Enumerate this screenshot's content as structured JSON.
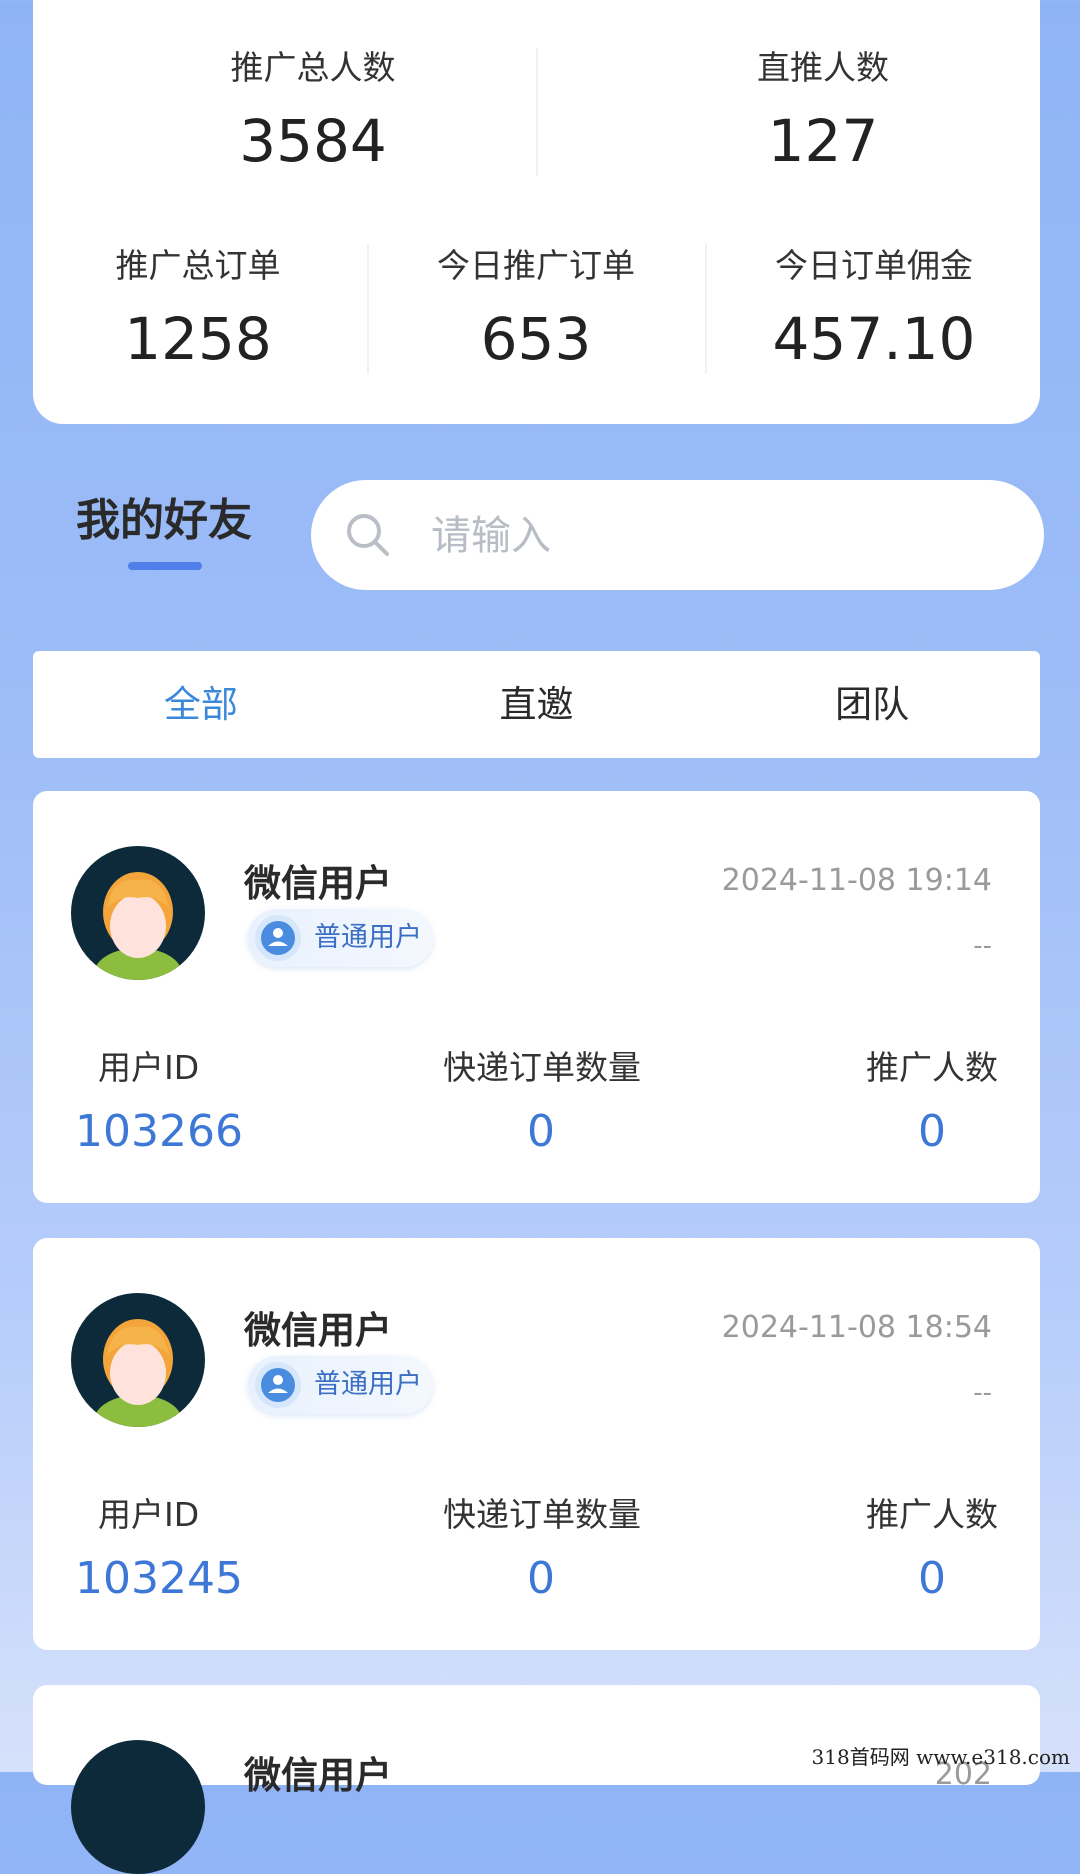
{
  "stats": {
    "promo_total_people": {
      "label": "推广总人数",
      "value": "3584"
    },
    "direct_people": {
      "label": "直推人数",
      "value": "127"
    },
    "promo_total_orders": {
      "label": "推广总订单",
      "value": "1258"
    },
    "today_promo_orders": {
      "label": "今日推广订单",
      "value": "653"
    },
    "today_commission": {
      "label": "今日订单佣金",
      "value": "457.10"
    }
  },
  "section": {
    "title": "我的好友"
  },
  "search": {
    "placeholder": "请输入",
    "icon": "search-icon"
  },
  "tabs": [
    {
      "label": "全部",
      "active": true
    },
    {
      "label": "直邀",
      "active": false
    },
    {
      "label": "团队",
      "active": false
    }
  ],
  "columns": {
    "user_id": "用户ID",
    "express_orders": "快递订单数量",
    "promo_people": "推广人数"
  },
  "users": [
    {
      "name": "微信用户",
      "badge": "普通用户",
      "time": "2024-11-08 19:14",
      "extra": "--",
      "id": "103266",
      "express_orders": "0",
      "promo_people": "0"
    },
    {
      "name": "微信用户",
      "badge": "普通用户",
      "time": "2024-11-08 18:54",
      "extra": "--",
      "id": "103245",
      "express_orders": "0",
      "promo_people": "0"
    },
    {
      "name": "微信用户",
      "badge": "",
      "time": "202",
      "extra": "",
      "id": "",
      "express_orders": "",
      "promo_people": ""
    }
  ],
  "watermark": "318首码网  www.e318.com",
  "colors": {
    "accent": "#3d78d6",
    "tab_active": "#3b88d8",
    "underline": "#4f7fe8",
    "bg_top": "#8fb4f6",
    "bg_bottom": "#d6e1fb"
  }
}
